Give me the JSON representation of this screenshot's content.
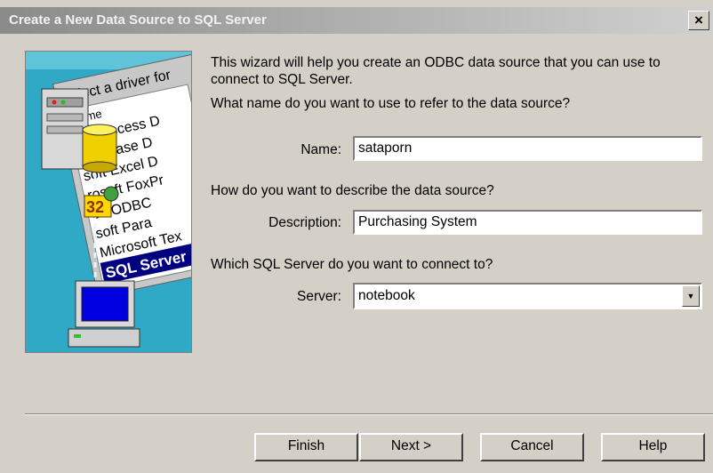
{
  "window": {
    "title": "Create a New Data Source to SQL Server",
    "close_label": "×"
  },
  "illustration": {
    "header": "Select a driver for",
    "items": [
      "Name",
      "soft Access D",
      "oft dBase D",
      "soft Excel D",
      "rosoft FoxPr",
      "oft ODBC",
      "soft Para",
      "Microsoft Tex",
      "SQL Server"
    ],
    "badge": "32"
  },
  "intro": "This wizard will help you create an ODBC data source that you can use to connect to SQL Server.",
  "name_section": {
    "question": "What name do you want to use to refer to the data source?",
    "label": "Name:",
    "value": "sataporn"
  },
  "description_section": {
    "question": "How do you want to describe the data source?",
    "label": "Description:",
    "value": "Purchasing System"
  },
  "server_section": {
    "question": "Which SQL Server do you want to connect to?",
    "label": "Server:",
    "value": "notebook"
  },
  "buttons": {
    "finish": "Finish",
    "next": "Next >",
    "cancel": "Cancel",
    "help": "Help"
  }
}
